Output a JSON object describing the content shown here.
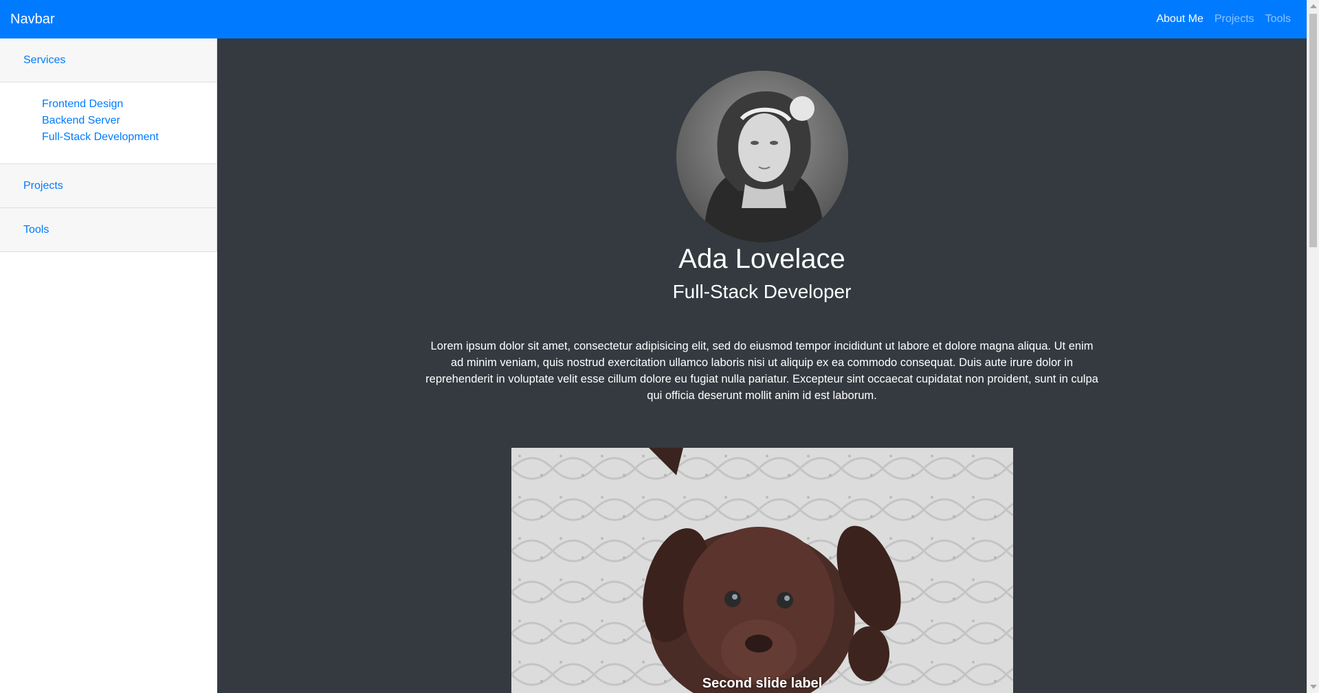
{
  "navbar": {
    "brand": "Navbar",
    "links": [
      {
        "label": "About Me",
        "active": true
      },
      {
        "label": "Projects",
        "active": false
      },
      {
        "label": "Tools",
        "active": false
      }
    ],
    "color": "#007bff"
  },
  "sidebar": {
    "sections": [
      {
        "label": "Services",
        "items": [
          "Frontend Design",
          "Backend Server",
          "Full-Stack Development"
        ]
      },
      {
        "label": "Projects"
      },
      {
        "label": "Tools"
      }
    ]
  },
  "profile": {
    "name": "Ada Lovelace",
    "role": "Full-Stack Developer",
    "bio": "Lorem ipsum dolor sit amet, consectetur adipisicing elit, sed do eiusmod tempor incididunt ut labore et dolore magna aliqua. Ut enim ad minim veniam, quis nostrud exercitation ullamco laboris nisi ut aliquip ex ea commodo consequat. Duis aute irure dolor in reprehenderit in voluptate velit esse cillum dolore eu fugiat nulla pariatur. Excepteur sint occaecat cupidatat non proident, sunt in culpa qui officia deserunt mollit anim id est laborum."
  },
  "carousel": {
    "caption": "Second slide label"
  },
  "colors": {
    "main_bg": "#343a40",
    "link": "#007bff"
  }
}
